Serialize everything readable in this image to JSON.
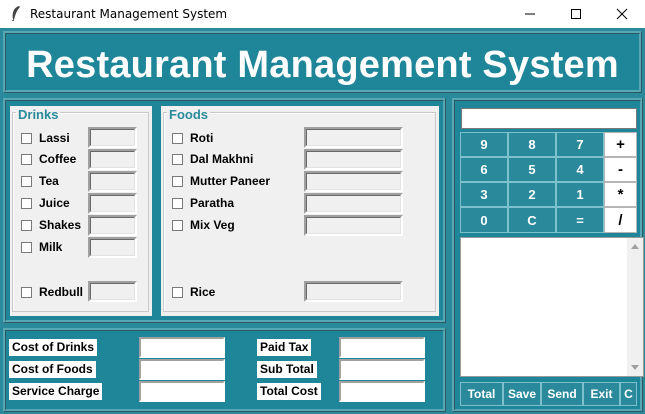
{
  "window": {
    "title": "Restaurant Management System"
  },
  "header": {
    "title": "Restaurant Management System"
  },
  "drinks": {
    "title": "Drinks",
    "items": [
      "Lassi",
      "Coffee",
      "Tea",
      "Juice",
      "Shakes",
      "Milk"
    ],
    "extra": "Redbull"
  },
  "foods": {
    "title": "Foods",
    "items": [
      "Roti",
      "Dal Makhni",
      "Mutter Paneer",
      "Paratha",
      "Mix Veg"
    ],
    "extra": "Rice"
  },
  "costs": {
    "cost_of_drinks": "Cost of Drinks",
    "cost_of_foods": "Cost of Foods",
    "service_charge": "Service Charge",
    "paid_tax": "Paid Tax",
    "sub_total": "Sub Total",
    "total_cost": "Total Cost"
  },
  "calculator": {
    "keys": [
      [
        "9",
        "8",
        "7",
        "+"
      ],
      [
        "6",
        "5",
        "4",
        "-"
      ],
      [
        "3",
        "2",
        "1",
        "*"
      ],
      [
        "0",
        "C",
        "=",
        "/"
      ]
    ]
  },
  "buttons": {
    "total": "Total",
    "save": "Save",
    "send": "Send",
    "exit": "Exit",
    "c": "C"
  },
  "colors": {
    "accent": "#2a8a9c",
    "panel": "#f0f0f0",
    "text_light": "#ffffff"
  }
}
